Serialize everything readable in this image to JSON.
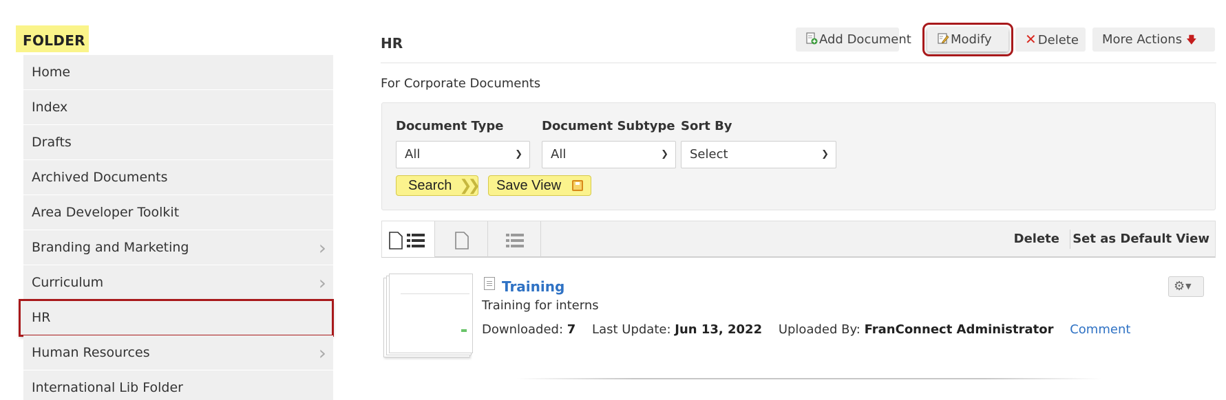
{
  "sidebar": {
    "heading": "FOLDER",
    "items": [
      {
        "label": "Home",
        "has_children": false
      },
      {
        "label": "Index",
        "has_children": false
      },
      {
        "label": "Drafts",
        "has_children": false
      },
      {
        "label": "Archived Documents",
        "has_children": false
      },
      {
        "label": "Area Developer Toolkit",
        "has_children": false
      },
      {
        "label": "Branding and Marketing",
        "has_children": true
      },
      {
        "label": "Curriculum",
        "has_children": true
      },
      {
        "label": "HR",
        "has_children": false,
        "selected": true
      },
      {
        "label": "Human Resources",
        "has_children": true
      },
      {
        "label": "International Lib Folder",
        "has_children": false
      }
    ]
  },
  "header": {
    "title": "HR",
    "description": "For Corporate Documents"
  },
  "toolbar": {
    "add_label": "Add Document",
    "modify_label": "Modify",
    "delete_label": "Delete",
    "more_label": "More Actions"
  },
  "filters": {
    "document_type": {
      "label": "Document Type",
      "value": "All"
    },
    "document_subtype": {
      "label": "Document Subtype",
      "value": "All"
    },
    "sort_by": {
      "label": "Sort By",
      "value": "Select"
    },
    "search_label": "Search",
    "save_view_label": "Save View"
  },
  "view_bar": {
    "delete_label": "Delete",
    "default_label": "Set as Default View"
  },
  "document": {
    "title": "Training",
    "description": "Training for interns",
    "downloaded_label": "Downloaded:",
    "downloaded_value": "7",
    "last_update_label": "Last Update:",
    "last_update_value": "Jun 13, 2022",
    "uploaded_by_label": "Uploaded By:",
    "uploaded_by_value": "FranConnect Administrator",
    "comment_label": "Comment"
  },
  "colors": {
    "accent_link": "#2f72c4",
    "highlight_yellow": "#fbf38d",
    "annotation_red": "#a8191b"
  }
}
